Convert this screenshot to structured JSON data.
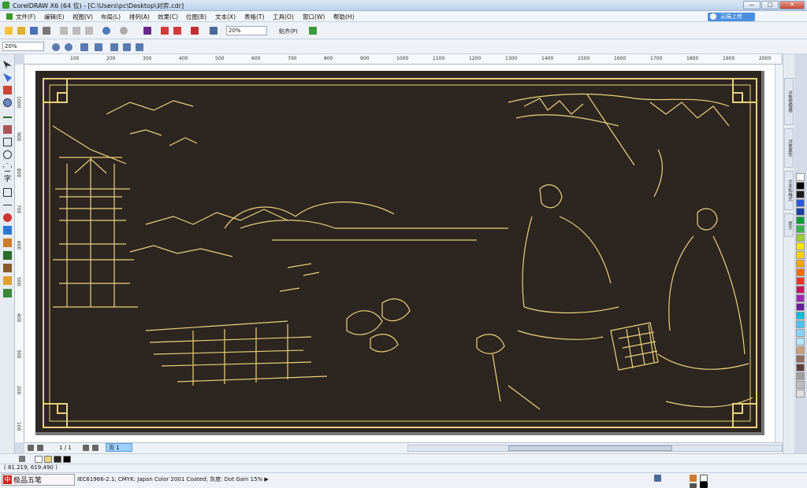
{
  "window": {
    "title": "CorelDRAW X6 (64 位) - [C:\\Users\\pc\\Desktop\\对弈.cdr]",
    "minimize": "—",
    "maximize": "□",
    "close": "✕"
  },
  "menu": {
    "items": [
      "文件(F)",
      "编辑(E)",
      "视图(V)",
      "布局(L)",
      "排列(A)",
      "效果(C)",
      "位图(B)",
      "文本(X)",
      "表格(T)",
      "工具(O)",
      "窗口(W)",
      "帮助(H)"
    ],
    "cloud_button": "云端上传"
  },
  "toolbar": {
    "zoom_value": "20%",
    "snap_label": "贴齐(P)"
  },
  "propbar": {
    "zoom_value": "20%"
  },
  "ruler": {
    "unit": "毫米",
    "ticks": [
      "100",
      "200",
      "300",
      "400",
      "500",
      "600",
      "700",
      "800",
      "900",
      "1000",
      "1100",
      "1200",
      "1300",
      "1400",
      "1500",
      "1600",
      "1700",
      "1800",
      "1900",
      "2000"
    ],
    "vticks": [
      "1000",
      "900",
      "800",
      "700",
      "600",
      "500",
      "400",
      "300",
      "200",
      "100"
    ]
  },
  "pagenav": {
    "count": "1 / 1",
    "page_tab": "页 1"
  },
  "status": {
    "cursor": "( 81.219, 619.490 )",
    "color_profile": "IEC61966-2.1; CMYK: Japan Color 2001 Coated; 灰度: Dot Gain 15% ▶"
  },
  "ime": {
    "logo": "中",
    "text": "极品五笔"
  },
  "docker": {
    "tabs": [
      "对象管理器",
      "对象属性",
      "文本和格式",
      "提示"
    ]
  },
  "colors": {
    "artwork_bg": "#2d2520",
    "gold": "#e8d27a",
    "accent": "#4a8fe0"
  },
  "palette": [
    "#ffffff",
    "#000000",
    "#1a1a1a",
    "#2a5ad8",
    "#1c3fa0",
    "#0b9a3a",
    "#3bb34a",
    "#9acd32",
    "#f2e600",
    "#ffd200",
    "#f7a800",
    "#f26b00",
    "#e8352b",
    "#c2185b",
    "#9c27b0",
    "#6a1b9a",
    "#00bcd4",
    "#4fc3f7",
    "#81d4fa",
    "#b3e5fc",
    "#c8a27a",
    "#8d6e63",
    "#5d4037",
    "#9e9e9e",
    "#bdbdbd",
    "#e0e0e0"
  ]
}
